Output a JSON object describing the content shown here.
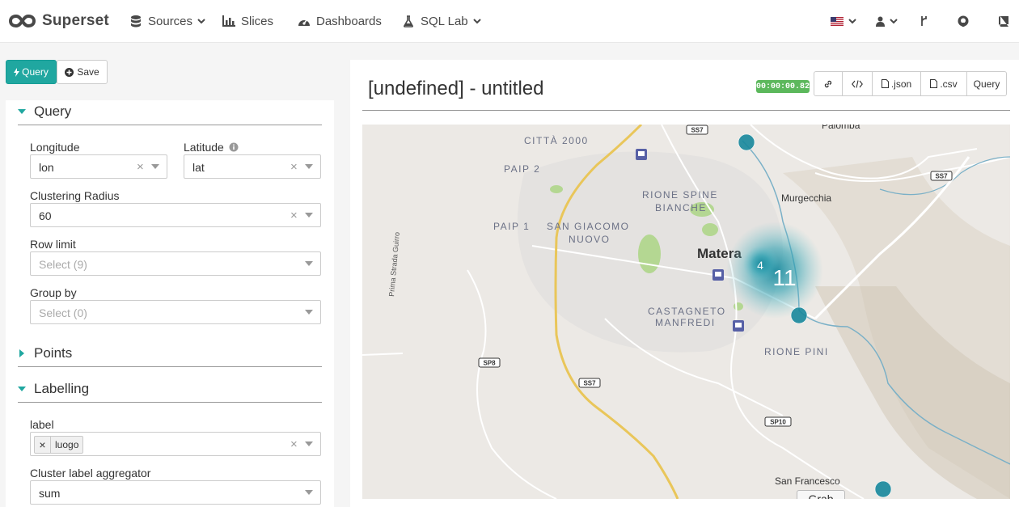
{
  "navbar": {
    "brand": "Superset",
    "items": [
      {
        "label": "Sources",
        "icon": "database-icon"
      },
      {
        "label": "Slices",
        "icon": "bar-chart-icon"
      },
      {
        "label": "Dashboards",
        "icon": "dashboard-icon"
      },
      {
        "label": "SQL Lab",
        "icon": "flask-icon"
      }
    ]
  },
  "toolbar": {
    "query_label": "Query",
    "save_label": "Save"
  },
  "sections": {
    "query": "Query",
    "points": "Points",
    "labelling": "Labelling"
  },
  "fields": {
    "longitude": {
      "label": "Longitude",
      "value": "lon"
    },
    "latitude": {
      "label": "Latitude",
      "value": "lat"
    },
    "radius": {
      "label": "Clustering Radius",
      "value": "60"
    },
    "row_limit": {
      "label": "Row limit",
      "placeholder": "Select (9)"
    },
    "group_by": {
      "label": "Group by",
      "placeholder": "Select (0)"
    },
    "label": {
      "label": "label",
      "tag": "luogo"
    },
    "aggregator": {
      "label": "Cluster label aggregator",
      "value": "sum"
    }
  },
  "chart": {
    "title": "[undefined] - untitled",
    "timer": "00:00:00.82",
    "buttons": {
      "json": ".json",
      "csv": ".csv",
      "query": "Query"
    }
  },
  "map": {
    "labels": {
      "citta2000": "CITTÀ 2000",
      "paip2": "PAIP 2",
      "paip1": "PAIP 1",
      "sangiacomo1": "SAN GIACOMO",
      "sangiacomo2": "NUOVO",
      "rionespine1": "RIONE SPINE",
      "rionespine2": "BIANCHE",
      "matera": "Matera",
      "castagneto1": "CASTAGNETO",
      "castagneto2": "MANFREDI",
      "rionepini": "RIONE PINI",
      "murgecchia": "Murgecchia",
      "palomba": "Palomba",
      "sanfrancesco": "San Francesco",
      "primastrada": "Prima Strada Guirro",
      "ss7a": "SS7",
      "ss7b": "SS7",
      "ss7c": "SS7",
      "sp8": "SP8",
      "sp10": "SP10"
    },
    "clusters": [
      "11",
      "4"
    ],
    "grab": "Grab",
    "colors": {
      "cluster": "#18889c",
      "road": "#e9c65a",
      "water": "#7ab0c7",
      "park": "#a8d57e"
    }
  }
}
